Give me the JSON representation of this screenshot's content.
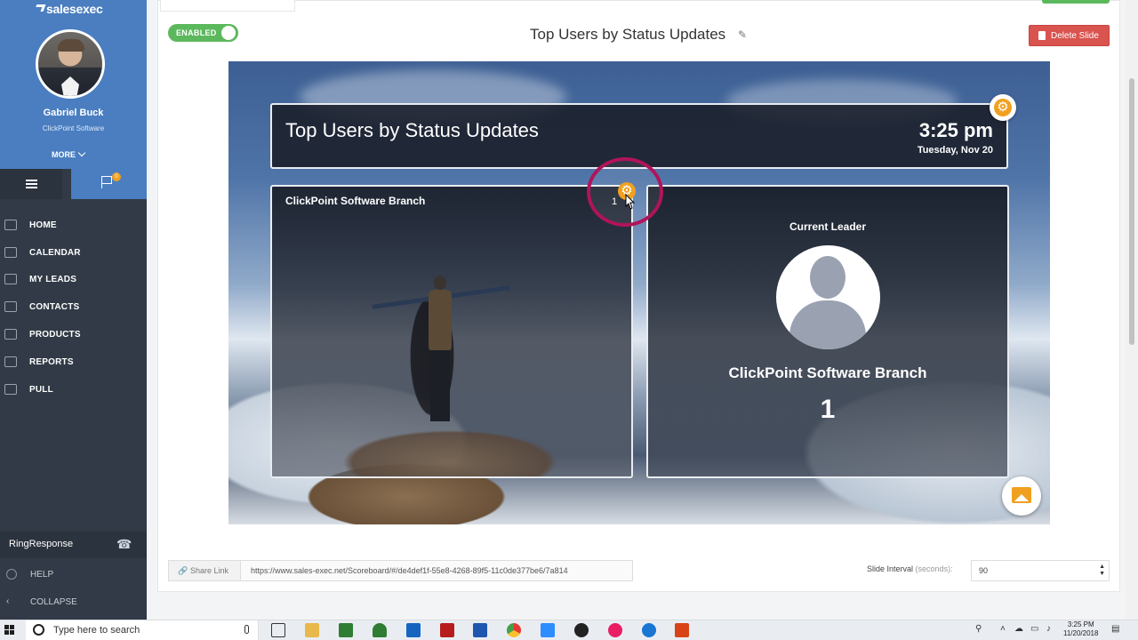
{
  "sidebar": {
    "brand": "salesexec",
    "user_name": "Gabriel Buck",
    "user_company": "ClickPoint Software",
    "more_label": "MORE",
    "flag_count": "0",
    "nav": [
      {
        "label": "HOME",
        "icon": "home-icon"
      },
      {
        "label": "CALENDAR",
        "icon": "calendar-icon"
      },
      {
        "label": "MY LEADS",
        "icon": "leads-icon"
      },
      {
        "label": "CONTACTS",
        "icon": "contacts-icon"
      },
      {
        "label": "PRODUCTS",
        "icon": "products-icon"
      },
      {
        "label": "REPORTS",
        "icon": "reports-icon"
      },
      {
        "label": "PULL",
        "icon": "pull-icon"
      }
    ],
    "ring_response": "RingResponse",
    "help": "HELP",
    "collapse": "COLLAPSE"
  },
  "toolbar": {
    "toggle_label": "ENABLED",
    "slide_title": "Top Users by Status Updates",
    "delete_label": "Delete Slide"
  },
  "slide": {
    "header_title": "Top Users by Status Updates",
    "time": "3:25 pm",
    "date": "Tuesday, Nov 20",
    "branch_title": "ClickPoint Software Branch",
    "branch_count": "1",
    "leader_label": "Current Leader",
    "leader_name": "ClickPoint Software Branch",
    "leader_score": "1"
  },
  "footer": {
    "share_label": "Share Link",
    "share_url": "https://www.sales-exec.net/Scoreboard/#/de4def1f-55e8-4268-89f5-11c0de377be6/7a814",
    "interval_label": "Slide Interval",
    "interval_unit": "(seconds):",
    "interval_value": "90"
  },
  "taskbar": {
    "search_placeholder": "Type here to search",
    "time": "3:25 PM",
    "date": "11/20/2018"
  },
  "colors": {
    "sidebar_bg": "#313a46",
    "sidebar_accent": "#4a7ec0",
    "enabled_green": "#5cb85c",
    "delete_red": "#d9534f",
    "gear_orange": "#f0a020",
    "highlight_ring": "#b0145a"
  }
}
